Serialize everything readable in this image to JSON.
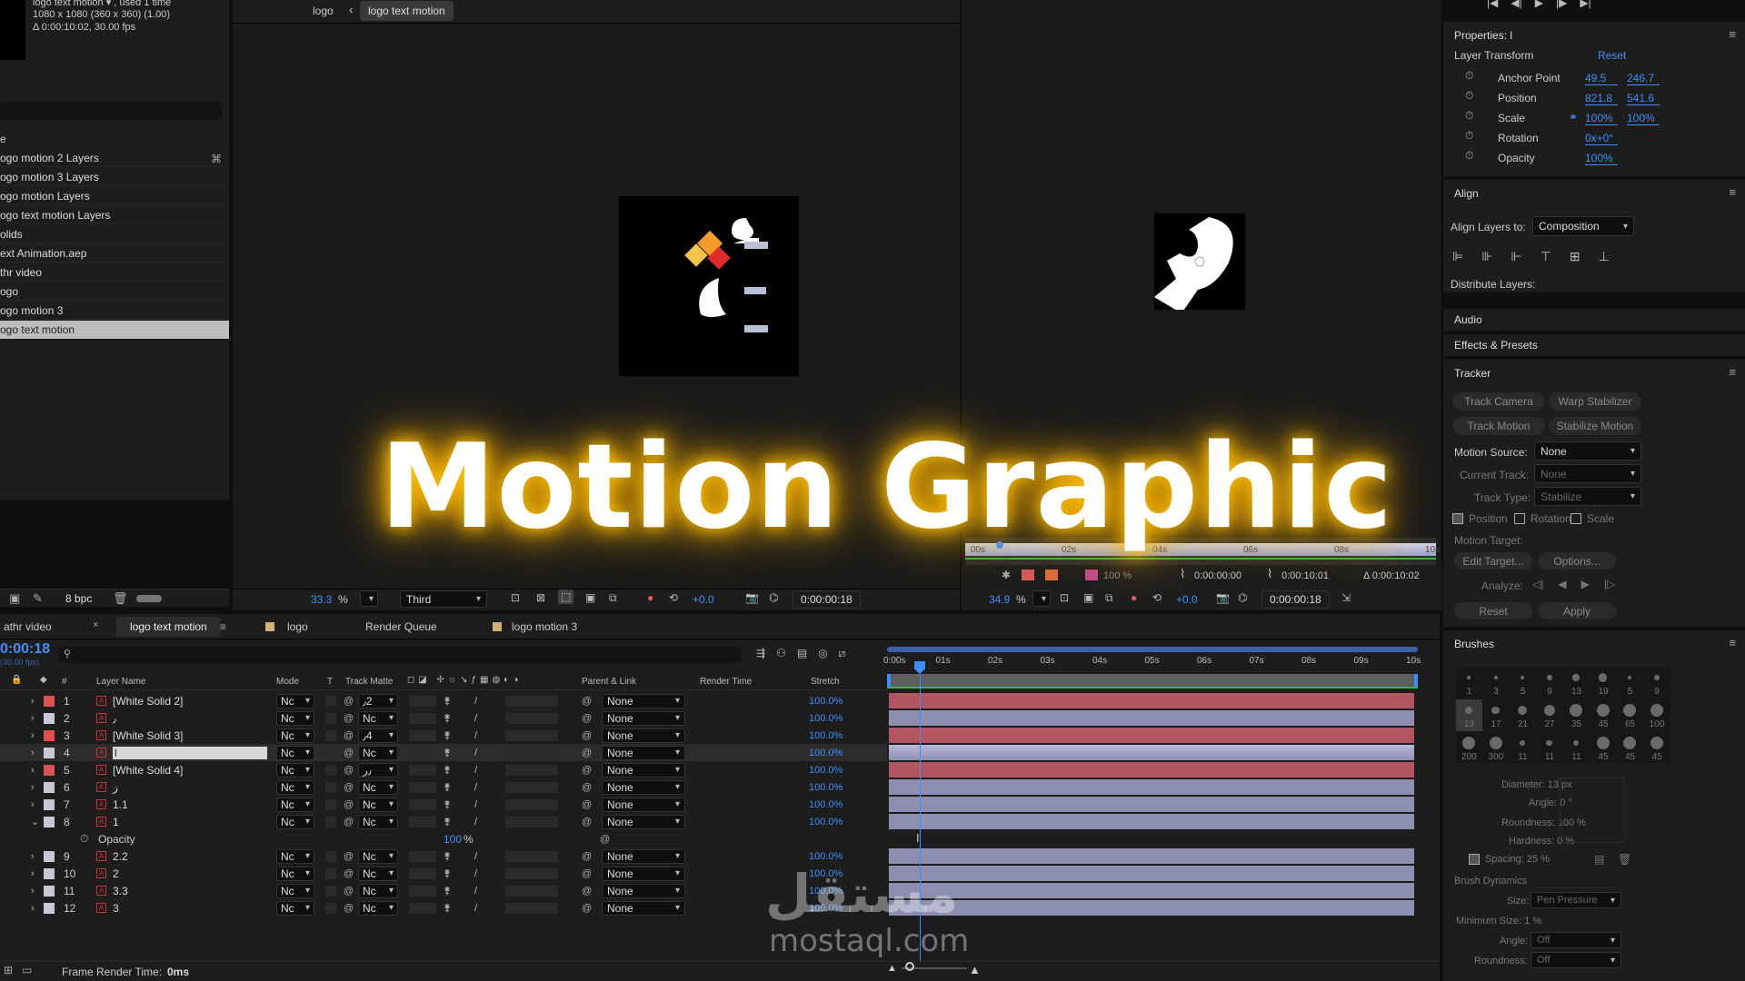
{
  "project": {
    "comp_name": "logo text motion ▾ , used 1 time",
    "comp_info": "1080 x 1080  (360 x 360) (1.00)",
    "comp_duration": "Δ 0:00:10:02, 30.00 fps",
    "col_header": "e",
    "items": [
      {
        "label": "ogo motion 2 Layers"
      },
      {
        "label": "ogo motion 3 Layers"
      },
      {
        "label": "ogo motion Layers"
      },
      {
        "label": "ogo text motion Layers"
      },
      {
        "label": "olids"
      },
      {
        "label": "ext Animation.aep"
      },
      {
        "label": "thr video"
      },
      {
        "label": "ogo"
      },
      {
        "label": "ogo motion 3"
      },
      {
        "label": "ogo text motion"
      }
    ],
    "bpc": "8 bpc"
  },
  "viewer": {
    "tab_logo": "logo",
    "tab_active": "logo text motion",
    "zoom": "33.3",
    "zoom_unit": "%",
    "resolution": "Third",
    "exposure": "+0.0",
    "timecode": "0:00:00:18"
  },
  "viewer2": {
    "zoom": "34.9",
    "zoom_unit": "%",
    "exposure": "+0.0",
    "timecode": "0:00:00:18",
    "mini_ticks": [
      "00s",
      "02s",
      "04s",
      "06s",
      "08s",
      "10s"
    ],
    "pct": "100 %",
    "t_in": "0:00:00:00",
    "t_out": "0:00:10:01",
    "t_dur": "Δ 0:00:10:02"
  },
  "overlay": {
    "title": "Motion Graphic",
    "watermark_ar": "مستقل",
    "watermark_url": "mostaql.com"
  },
  "properties": {
    "title": "Properties: l",
    "section": "Layer Transform",
    "reset": "Reset",
    "rows": [
      {
        "label": "Anchor Point",
        "v1": "49.5",
        "v2": "246.7"
      },
      {
        "label": "Position",
        "v1": "821.8",
        "v2": "541.6"
      },
      {
        "label": "Scale",
        "v1": "100%",
        "v2": "100%"
      },
      {
        "label": "Rotation",
        "v1": "0x+0°",
        "v2": ""
      },
      {
        "label": "Opacity",
        "v1": "100%",
        "v2": ""
      }
    ]
  },
  "align": {
    "title": "Align",
    "align_to_label": "Align Layers to:",
    "align_to_value": "Composition",
    "distribute": "Distribute Layers:"
  },
  "audio": {
    "title": "Audio"
  },
  "effects": {
    "title": "Effects & Presets"
  },
  "tracker": {
    "title": "Tracker",
    "track_camera": "Track Camera",
    "warp_stabilizer": "Warp Stabilizer",
    "track_motion": "Track Motion",
    "stabilize_motion": "Stabilize Motion",
    "motion_source_label": "Motion Source:",
    "motion_source": "None",
    "current_track_label": "Current Track:",
    "current_track": "None",
    "track_type_label": "Track Type:",
    "track_type": "Stabilize",
    "cb_position": "Position",
    "cb_rotation": "Rotation",
    "cb_scale": "Scale",
    "motion_target": "Motion Target:",
    "edit_target": "Edit Target...",
    "options": "Options...",
    "analyze": "Analyze:",
    "reset": "Reset",
    "apply": "Apply"
  },
  "brushes": {
    "title": "Brushes",
    "sizes_row1": [
      "1",
      "3",
      "5",
      "9",
      "13",
      "19",
      "5",
      "9"
    ],
    "sizes_row2": [
      "13",
      "17",
      "21",
      "27",
      "35",
      "45",
      "65",
      "100"
    ],
    "sizes_row3": [
      "200",
      "300",
      "11",
      "11",
      "11",
      "45",
      "45",
      "45"
    ],
    "diameter": "Diameter: 13 px",
    "angle": "Angle: 0 °",
    "roundness": "Roundness: 100 %",
    "hardness": "Hardness: 0 %",
    "spacing": "Spacing: 25 %",
    "dynamics": "Brush Dynamics",
    "size_label": "Size:",
    "size_value": "Pen Pressure",
    "min_size": "Minimum Size: 1 %",
    "angle_label": "Angle:",
    "angle_value": "Off",
    "roundness_label": "Roundness:",
    "roundness_value": "Off"
  },
  "timeline": {
    "tab1": "athr video",
    "tab2": "logo text motion",
    "tab3": "logo",
    "tab4": "Render Queue",
    "tab5": "logo motion 3",
    "timecode": "0:00:18",
    "fps": "(30.00 fps)",
    "headers": {
      "layer_name": "Layer Name",
      "mode": "Mode",
      "t": "T",
      "track_matte": "Track Matte",
      "parent": "Parent & Link",
      "render_time": "Render Time",
      "stretch": "Stretch"
    },
    "ruler": [
      "0:00s",
      "01s",
      "02s",
      "03s",
      "04s",
      "05s",
      "06s",
      "07s",
      "08s",
      "09s",
      "10s"
    ],
    "layers": [
      {
        "num": "1",
        "name": "[White Solid 2]",
        "mode": "Nc",
        "matte": "٫2",
        "parent": "None",
        "stretch": "100.0%",
        "color": "#ffffff",
        "bar": "#b25560",
        "label": "#d9534f"
      },
      {
        "num": "2",
        "name": "٫",
        "mode": "Nc",
        "matte": "Nc",
        "parent": "None",
        "stretch": "100.0%",
        "color": "#ffffff",
        "bar": "#8c8fb0",
        "label": "#c7c7d7"
      },
      {
        "num": "3",
        "name": "[White Solid 3]",
        "mode": "Nc",
        "matte": "٫4",
        "parent": "None",
        "stretch": "100.0%",
        "color": "#ffffff",
        "bar": "#b25560",
        "label": "#d9534f"
      },
      {
        "num": "4",
        "name": "l",
        "mode": "Nc",
        "matte": "Nc",
        "parent": "None",
        "stretch": "100.0%",
        "color": "#ffffff",
        "bar": "#9a9dc0",
        "label": "#c7c7d7"
      },
      {
        "num": "5",
        "name": "[White Solid 4]",
        "mode": "Nc",
        "matte": "٫ر",
        "parent": "None",
        "stretch": "100.0%",
        "color": "#ffffff",
        "bar": "#b25560",
        "label": "#d9534f"
      },
      {
        "num": "6",
        "name": "ز",
        "mode": "Nc",
        "matte": "Nc",
        "parent": "None",
        "stretch": "100.0%",
        "color": "#ffffff",
        "bar": "#8c8fb0",
        "label": "#c7c7d7"
      },
      {
        "num": "7",
        "name": "1.1",
        "mode": "Nc",
        "matte": "Nc",
        "parent": "None",
        "stretch": "100.0%",
        "color": "#ffffff",
        "bar": "#8c8fb0",
        "label": "#c7c7d7"
      },
      {
        "num": "8",
        "name": "1",
        "mode": "Nc",
        "matte": "Nc",
        "parent": "None",
        "stretch": "100.0%",
        "color": "#ffffff",
        "bar": "#8c8fb0",
        "label": "#c7c7d7"
      }
    ],
    "opacity_label": "Opacity",
    "opacity_value": "100",
    "layers2": [
      {
        "num": "9",
        "name": "2.2",
        "mode": "Nc",
        "matte": "Nc",
        "parent": "None",
        "stretch": "100.0%"
      },
      {
        "num": "10",
        "name": "2",
        "mode": "Nc",
        "matte": "Nc",
        "parent": "None",
        "stretch": "100.0%"
      },
      {
        "num": "11",
        "name": "3.3",
        "mode": "Nc",
        "matte": "Nc",
        "parent": "None",
        "stretch": "100.0%"
      },
      {
        "num": "12",
        "name": "3",
        "mode": "Nc",
        "matte": "Nc",
        "parent": "None",
        "stretch": "100.0%"
      }
    ],
    "frame_render_label": "Frame Render Time:",
    "frame_render_value": "0ms"
  }
}
